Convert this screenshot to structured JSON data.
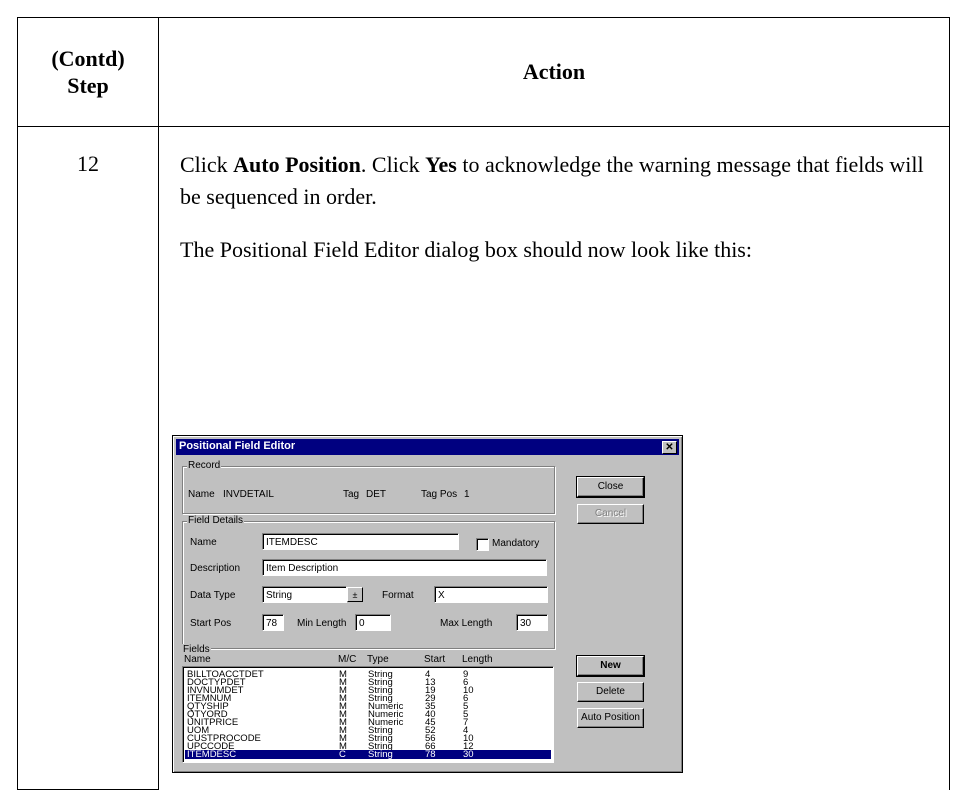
{
  "table": {
    "header_step": "(Contd)\nStep",
    "header_step_line1": "(Contd)",
    "header_step_line2": "Step",
    "header_action": "Action",
    "step_number": "12",
    "instruction": {
      "part1": "Click ",
      "bold1": "Auto Position",
      "part2": ". Click ",
      "bold2": "Yes",
      "part3": " to acknowledge the warning message that fields will be sequenced in order."
    },
    "dialog_caption": "The Positional Field Editor dialog box should now look like this:"
  },
  "dialog": {
    "title": "Positional Field Editor",
    "close_glyph": "✕",
    "record": {
      "group_label": "Record",
      "name_label": "Name",
      "name_value": "INVDETAIL",
      "tag_label": "Tag",
      "tag_value": "DET",
      "tagpos_label": "Tag Pos",
      "tagpos_value": "1"
    },
    "field_details": {
      "group_label": "Field Details",
      "name_label": "Name",
      "name_value": "ITEMDESC",
      "mandatory_label": "Mandatory",
      "description_label": "Description",
      "description_value": "Item Description",
      "datatype_label": "Data Type",
      "datatype_value": "String",
      "format_label": "Format",
      "format_value": "X",
      "startpos_label": "Start Pos",
      "startpos_value": "78",
      "minlength_label": "Min Length",
      "minlength_value": "0",
      "maxlength_label": "Max Length",
      "maxlength_value": "30"
    },
    "fields": {
      "group_label": "Fields",
      "columns": [
        "Name",
        "M/C",
        "Type",
        "Start",
        "Length"
      ],
      "rows": [
        [
          "BILLTOACCTDET",
          "M",
          "String",
          "4",
          "9"
        ],
        [
          "DOCTYPDET",
          "M",
          "String",
          "13",
          "6"
        ],
        [
          "INVNUMDET",
          "M",
          "String",
          "19",
          "10"
        ],
        [
          "ITEMNUM",
          "M",
          "String",
          "29",
          "6"
        ],
        [
          "QTYSHIP",
          "M",
          "Numeric",
          "35",
          "5"
        ],
        [
          "QTYORD",
          "M",
          "Numeric",
          "40",
          "5"
        ],
        [
          "UNITPRICE",
          "M",
          "Numeric",
          "45",
          "7"
        ],
        [
          "UOM",
          "M",
          "String",
          "52",
          "4"
        ],
        [
          "CUSTPROCODE",
          "M",
          "String",
          "56",
          "10"
        ],
        [
          "UPCCODE",
          "M",
          "String",
          "66",
          "12"
        ],
        [
          "ITEMDESC",
          "C",
          "String",
          "78",
          "30"
        ]
      ],
      "selected_row": 10
    },
    "buttons": {
      "close": "Close",
      "cancel": "Cancel",
      "new": "New",
      "delete": "Delete",
      "auto_position": "Auto Position"
    }
  }
}
